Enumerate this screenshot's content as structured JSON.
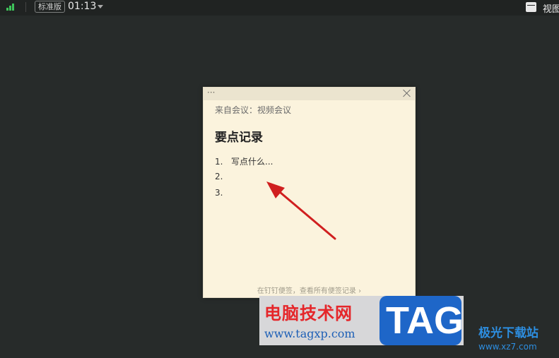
{
  "topbar": {
    "signal_icon": "signal-bars-icon",
    "badge": "标准版",
    "time": "01:13",
    "view_label": "视图"
  },
  "note": {
    "source": "来自会议：视频会议",
    "title": "要点记录",
    "items": [
      {
        "num": "1.",
        "text": "写点什么..."
      },
      {
        "num": "2.",
        "text": ""
      },
      {
        "num": "3.",
        "text": ""
      }
    ],
    "footer": "在钉钉便签，查看所有便签记录 ›"
  },
  "watermark": {
    "site_cn": "电脑技术网",
    "site_url": "www.tagxp.com",
    "tag": "TAG",
    "brand": "极光下载站",
    "brand_url": "www.xz7.com"
  },
  "colors": {
    "background": "#272b2a",
    "note_bg": "#fbf3dd",
    "signal": "#3ec45a",
    "arrow": "#d01f1f"
  }
}
